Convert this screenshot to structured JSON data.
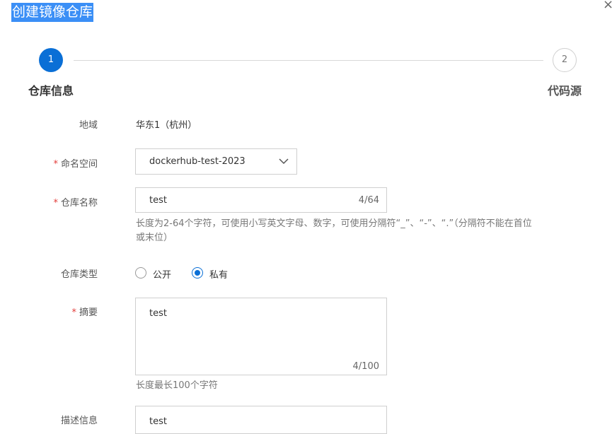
{
  "dialog": {
    "title": "创建镜像仓库",
    "close_symbol": "×"
  },
  "stepper": {
    "steps": [
      {
        "number": "1",
        "label": "仓库信息",
        "state": "active"
      },
      {
        "number": "2",
        "label": "代码源",
        "state": "inactive"
      }
    ]
  },
  "form": {
    "region": {
      "label": "地域",
      "value": "华东1（杭州）"
    },
    "namespace": {
      "required_mark": "*",
      "label": "命名空间",
      "value": "dockerhub-test-2023"
    },
    "repo_name": {
      "required_mark": "*",
      "label": "仓库名称",
      "value": "test",
      "count": "4/64",
      "hint_line1": "长度为2-64个字符，可使用小写英文字母、数字，可使用分隔符“_”、“-”、“.”（分隔符不能在首位",
      "hint_line2": "或末位）"
    },
    "repo_type": {
      "label": "仓库类型",
      "options": [
        {
          "label": "公开",
          "checked": false
        },
        {
          "label": "私有",
          "checked": true
        }
      ]
    },
    "summary": {
      "required_mark": "*",
      "label": "摘要",
      "value": "test",
      "count": "4/100",
      "hint": "长度最长100个字符"
    },
    "description": {
      "label": "描述信息",
      "value": "test"
    }
  },
  "colors": {
    "primary": "#0a6fd6",
    "title_highlight": "#3b8ff6",
    "required": "#e23c39"
  }
}
